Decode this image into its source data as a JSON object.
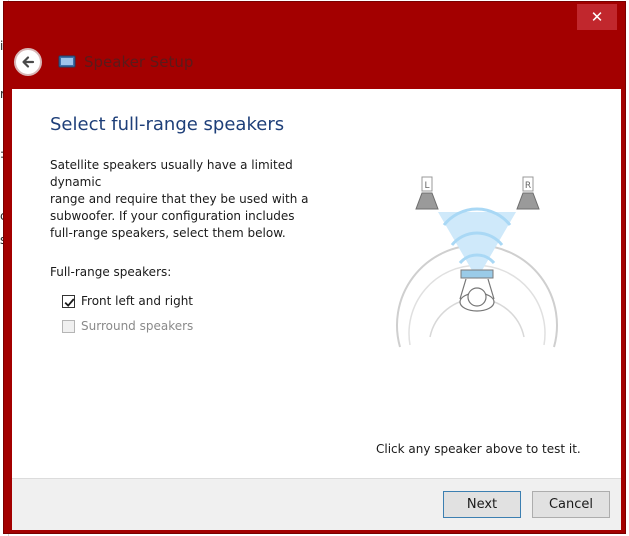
{
  "window": {
    "title": "Speaker Setup",
    "close_glyph": "✕",
    "accent_color": "#a30000"
  },
  "page": {
    "heading": "Select full-range speakers",
    "description_lines": [
      "Satellite speakers usually have a limited dynamic",
      "range and require that they be used with a",
      "subwoofer.  If your configuration includes",
      "full-range speakers, select them below."
    ],
    "group_label": "Full-range speakers:",
    "options": [
      {
        "label": "Front left and right",
        "checked": true,
        "enabled": true
      },
      {
        "label": "Surround speakers",
        "checked": false,
        "enabled": false
      }
    ],
    "diagram": {
      "left_speaker_label": "L",
      "right_speaker_label": "R"
    },
    "hint": "Click any speaker above to test it."
  },
  "footer": {
    "next_label": "Next",
    "cancel_label": "Cancel"
  },
  "icons": {
    "back": "back-arrow-icon",
    "app": "speaker-setup-icon",
    "close": "close-icon",
    "check": "checkmark-icon"
  }
}
